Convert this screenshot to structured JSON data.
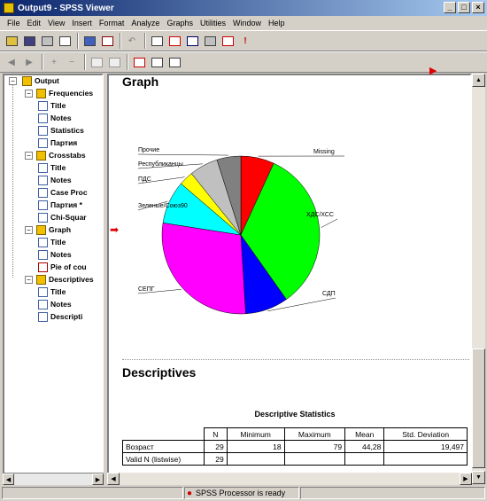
{
  "window": {
    "title": "Output9 - SPSS Viewer",
    "min": "_",
    "max": "□",
    "close": "×"
  },
  "menu": [
    "File",
    "Edit",
    "View",
    "Insert",
    "Format",
    "Analyze",
    "Graphs",
    "Utilities",
    "Window",
    "Help"
  ],
  "tree": {
    "root": "Output",
    "items": [
      {
        "label": "Frequencies",
        "type": "book"
      },
      {
        "label": "Title",
        "type": "page"
      },
      {
        "label": "Notes",
        "type": "page"
      },
      {
        "label": "Statistics",
        "type": "page"
      },
      {
        "label": "Партия",
        "type": "page"
      },
      {
        "label": "Crosstabs",
        "type": "book"
      },
      {
        "label": "Title",
        "type": "page"
      },
      {
        "label": "Notes",
        "type": "page"
      },
      {
        "label": "Case Proc",
        "type": "page"
      },
      {
        "label": "Партия *",
        "type": "page"
      },
      {
        "label": "Chi-Squar",
        "type": "page"
      },
      {
        "label": "Graph",
        "type": "book"
      },
      {
        "label": "Title",
        "type": "page"
      },
      {
        "label": "Notes",
        "type": "page"
      },
      {
        "label": "Pie of cou",
        "type": "chart"
      },
      {
        "label": "Descriptives",
        "type": "book"
      },
      {
        "label": "Title",
        "type": "page"
      },
      {
        "label": "Notes",
        "type": "page"
      },
      {
        "label": "Descripti",
        "type": "page"
      }
    ]
  },
  "viewer": {
    "graph_heading": "Graph",
    "desc_heading": "Descriptives",
    "table_title": "Descriptive Statistics",
    "table": {
      "headers": [
        "",
        "N",
        "Minimum",
        "Maximum",
        "Mean",
        "Std. Deviation"
      ],
      "rows": [
        [
          "Возраст",
          "29",
          "18",
          "79",
          "44,28",
          "19,497"
        ],
        [
          "Valid N (listwise)",
          "29",
          "",
          "",
          "",
          ""
        ]
      ]
    }
  },
  "chart_data": {
    "type": "pie",
    "slices": [
      {
        "label": "Missing",
        "value": 7,
        "color": "#ff0000"
      },
      {
        "label": "ХДС/ХСС",
        "value": 34,
        "color": "#00ff00"
      },
      {
        "label": "СДП",
        "value": 9,
        "color": "#0000ff"
      },
      {
        "label": "СЕПГ",
        "value": 29,
        "color": "#ff00ff"
      },
      {
        "label": "Зеленые/Союз90",
        "value": 9,
        "color": "#00ffff"
      },
      {
        "label": "ПДС",
        "value": 3,
        "color": "#ffff00"
      },
      {
        "label": "Республиканцы",
        "value": 6,
        "color": "#c0c0c0"
      },
      {
        "label": "Прочие",
        "value": 5,
        "color": "#808080"
      }
    ]
  },
  "status": {
    "text": "SPSS Processor  is ready"
  }
}
